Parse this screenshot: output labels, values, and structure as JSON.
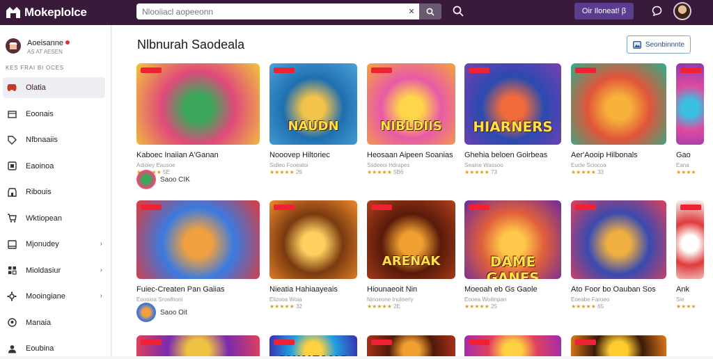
{
  "app": {
    "logo_text": "Mokeplolce"
  },
  "search": {
    "placeholder": "Nlooiiacl aopeeonn",
    "clear_icon": "close-icon"
  },
  "topbar": {
    "cta_label": "Oir Iloneat! β"
  },
  "sidebar": {
    "account_name": "Aoeisanne",
    "account_sub": "AS AT AESEN",
    "section_label": "KES FRAI BI OCES",
    "items": [
      {
        "label": "Olatia",
        "icon": "gamepad-icon",
        "active": true,
        "chevron": false
      },
      {
        "label": "Eoonais",
        "icon": "box-icon",
        "active": false,
        "chevron": false
      },
      {
        "label": "Nfbnaaiis",
        "icon": "tag-icon",
        "active": false,
        "chevron": false
      },
      {
        "label": "Eaoinoa",
        "icon": "square-icon",
        "active": false,
        "chevron": false
      },
      {
        "label": "Ribouis",
        "icon": "store-icon",
        "active": false,
        "chevron": false
      },
      {
        "label": "Wktiopean",
        "icon": "cart-icon",
        "active": false,
        "chevron": false
      },
      {
        "label": "Mjonudey",
        "icon": "window-icon",
        "active": false,
        "chevron": true
      },
      {
        "label": "Mioldasiur",
        "icon": "grid-icon",
        "active": false,
        "chevron": true
      },
      {
        "label": "Mooingiane",
        "icon": "gear-icon",
        "active": false,
        "chevron": true
      },
      {
        "label": "Manaia",
        "icon": "pin-icon",
        "active": false,
        "chevron": false
      },
      {
        "label": "Eoubina",
        "icon": "person-icon",
        "active": false,
        "chevron": false
      }
    ]
  },
  "main": {
    "title": "Nlbnurah Saodeala",
    "filter_label": "Seonbinnnte",
    "filter_icon": "image-icon",
    "row1": [
      {
        "title": "Kaboec Inaiian A'Ganan",
        "sub": "Adioiey Eausoe",
        "stars": "★★★★★ 5E",
        "seller": "Saoo CIK",
        "thumb_text": "",
        "colors": [
          "#f2c53d",
          "#e04a7a",
          "#3aa65a"
        ]
      },
      {
        "title": "Nooovep Hiltoriec",
        "sub": "Sidleo Fooeatoi",
        "stars": "★★★★★ 26",
        "seller": "",
        "thumb_text": "NAUDN",
        "colors": [
          "#4aa3d8",
          "#1f6fb0",
          "#f3c24a"
        ]
      },
      {
        "title": "Heosaan Aipeen Soanias",
        "sub": "Ssdeeoi Hdrapes",
        "stars": "★★★★★ 5B6",
        "seller": "",
        "thumb_text": "NIBLDIIS",
        "colors": [
          "#f4a53a",
          "#e85aa8",
          "#ffd54a"
        ]
      },
      {
        "title": "Ghehia beloen Goirbeas",
        "sub": "Seaine Wassoo",
        "stars": "★★★★★ 73",
        "seller": "",
        "thumb_text": "HIARNERS",
        "colors": [
          "#7a3fb0",
          "#2a4ab0",
          "#f06a3a"
        ]
      },
      {
        "title": "Aer'Aooip Hilbonals",
        "sub": "Eucle Sciocoa",
        "stars": "★★★★★ 33",
        "seller": "",
        "thumb_text": "",
        "colors": [
          "#2ab08a",
          "#e0553a",
          "#f7b23a"
        ]
      },
      {
        "title": "Gao",
        "sub": "Eana",
        "stars": "★★★★",
        "seller": "",
        "thumb_text": "",
        "colors": [
          "#8a3ab0",
          "#e04aa0",
          "#3ac0e0"
        ]
      }
    ],
    "row2": [
      {
        "title": "Fuiec-Createn Pan Gaiias",
        "sub": "Eoosioa Srowlhoni",
        "stars": "",
        "seller": "Saoo Oit",
        "thumb_text": "",
        "colors": [
          "#e03a3a",
          "#3a7ae0",
          "#f0a040"
        ]
      },
      {
        "title": "Nieatia Hahiaayeais",
        "sub": "Elizooa Woia",
        "stars": "★★★★★ 32",
        "seller": "",
        "thumb_text": "",
        "colors": [
          "#f08a2a",
          "#7a3a10",
          "#ffd060"
        ]
      },
      {
        "title": "Hiounaeoit Nin",
        "sub": "Ninoeone Inoloeriy",
        "stars": "★★★★★ 2E",
        "seller": "",
        "thumb_text": "ARENAK",
        "colors": [
          "#b0401a",
          "#5a1a0a",
          "#f0a030"
        ]
      },
      {
        "title": "Moeoah eb Gs Gaole",
        "sub": "Eooea Woilinpan",
        "stars": "★★★★★ 25",
        "seller": "",
        "thumb_text": "DAME GANES",
        "colors": [
          "#6a2aa0",
          "#e0603a",
          "#ffc84a"
        ]
      },
      {
        "title": "Ato Foor bo Oauban Sos",
        "sub": "Eoeabe Faroeo",
        "stars": "★★★★★ 65",
        "seller": "",
        "thumb_text": "",
        "colors": [
          "#e0405a",
          "#3a4ab0",
          "#f0b040"
        ]
      },
      {
        "title": "Ank",
        "sub": "Sie",
        "stars": "★★★★",
        "seller": "",
        "thumb_text": "",
        "colors": [
          "#f4f4f4",
          "#e03a3a",
          "#ffffff"
        ]
      }
    ],
    "row3": [
      {
        "thumb_text": "",
        "colors": [
          "#e0405a",
          "#7a2ab0",
          "#f0c040"
        ]
      },
      {
        "thumb_text": "SUINFANS",
        "colors": [
          "#3a2ab0",
          "#20a0e0",
          "#ffd040"
        ]
      },
      {
        "thumb_text": "",
        "colors": [
          "#b0301a",
          "#501a0a",
          "#f0a030"
        ]
      },
      {
        "thumb_text": "",
        "colors": [
          "#a02ab0",
          "#e04060",
          "#ffd040"
        ]
      },
      {
        "thumb_text": "",
        "colors": [
          "#e07a1a",
          "#3a1a0a",
          "#ffcc30"
        ]
      }
    ]
  }
}
